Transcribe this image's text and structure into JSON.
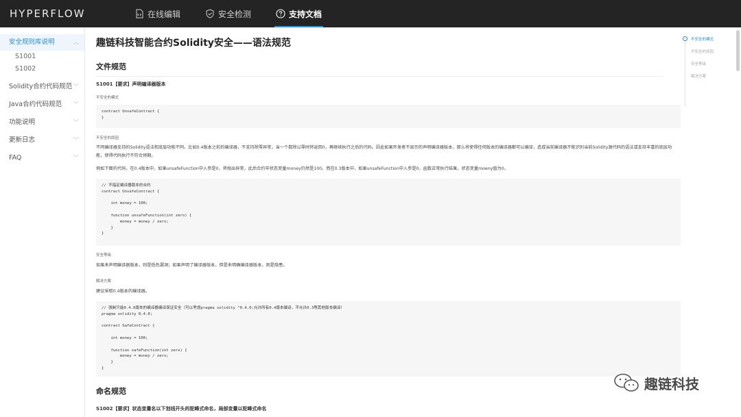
{
  "topbar": {
    "logo": "HYPERFLOW",
    "nav": [
      {
        "label": "在线编辑",
        "icon": "code-file-icon"
      },
      {
        "label": "安全检测",
        "icon": "shield-check-icon"
      },
      {
        "label": "支持文档",
        "icon": "help-circle-icon",
        "active": true
      }
    ]
  },
  "sidebar": {
    "items": [
      {
        "label": "安全规则库说明",
        "active": true,
        "expanded": true,
        "children": [
          "S1001",
          "S1002"
        ]
      },
      {
        "label": "Solidity合约代码规范"
      },
      {
        "label": "Java合约代码规范"
      },
      {
        "label": "功能说明"
      },
      {
        "label": "更新日志"
      },
      {
        "label": "FAQ"
      }
    ],
    "children": [
      "S1001",
      "S1002"
    ]
  },
  "toc": {
    "items": [
      "不安全的模式",
      "不安全的原因",
      "安全等级",
      "解决方案"
    ]
  },
  "main": {
    "title": "趣链科技智能合约Solidity安全——语法规范",
    "section1": "文件规范",
    "rule1": "S1001【要求】声明编译器版本",
    "unsafe_pattern_label": "不安全的模式",
    "code1": "contract UnsafeContract {\n}",
    "unsafe_reason_label": "不安全的原因",
    "reason_text": "不同编译器支持的Solidity语法和底层功能不同。比如0.4版本之前的编译器，不支持除零异常，当一个数除以零时将返回0，再继续执行之后的代码。因此如果开发者不显示的声明编译器版本，那么将使得任何版本的编译器都可以编译，造成当前编译器不能识别当前Solidity源代码的语法或支持丰富的底层功能，使得代码执行不符合预期。",
    "example_text": "例如下面的代码，在0.4版本中，如果unsafeFunction中入参是0，将抛出异常，此后合约中状态变量money仍然是100。而在0.3版本中，如果unsafeFunction中入参是0，函数正常执行结果，状态变量moeny值为0。",
    "code2": "// 不指定编译器版本的合约\ncontract UnsafeContract {\n\n    int money = 100;\n\n    function unsafeFunction(int zero) {\n        money = money / zero;\n    }\n}",
    "security_level_label": "安全等级",
    "security_level_text": "如果未声明编译器版本，则是低危漏洞；如果声明了编译器版本，但是未明确编译器版本，则是隐患。",
    "solution_label": "解决方案",
    "solution_text": "建议采取0.4版本的编译器。",
    "code3": "// 强制只能0.4.0版本的编译器编译保证安全（可以考虑pragma solidity ^0.4.0;允许所有0.4版本编译，不允许0.3等其他版本编译）\npragma solidity 0.4.0;\n\ncontract SafeContract {\n\n    int money = 100;\n\n    function safeFunction(int zero) {\n        money = money / zero;\n    }\n}",
    "section2": "命名规范",
    "rule2": "S1002【要求】状态变量名以下划线开头的驼峰式命名，局部变量以驼峰式命名"
  },
  "watermark": {
    "text": "趣链科技",
    "icon": "wechat-icon"
  },
  "colors": {
    "topbar": "#242424",
    "accent": "#2a8ed6",
    "code_bg": "#f6f6f6"
  }
}
